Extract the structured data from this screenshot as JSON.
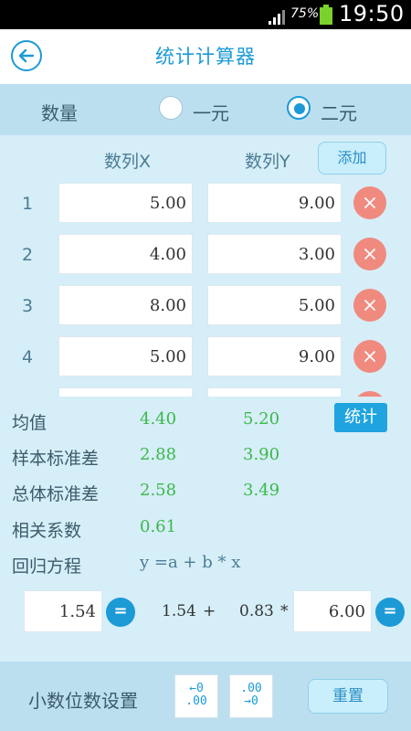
{
  "status_bar": {
    "battery_pct": "75%",
    "time": "19:50",
    "signal_icon": "signal-icon",
    "battery_icon": "battery-icon"
  },
  "header": {
    "title": "统计计算器",
    "back_icon": "back-arrow-icon"
  },
  "mode": {
    "label": "数量",
    "options": [
      "一元",
      "二元"
    ],
    "selected": "二元"
  },
  "table": {
    "col_x": "数列X",
    "col_y": "数列Y",
    "add_label": "添加",
    "rows": [
      {
        "index": "1",
        "x": "5.00",
        "y": "9.00"
      },
      {
        "index": "2",
        "x": "4.00",
        "y": "3.00"
      },
      {
        "index": "3",
        "x": "8.00",
        "y": "5.00"
      },
      {
        "index": "4",
        "x": "5.00",
        "y": "9.00"
      }
    ]
  },
  "stats": {
    "button_label": "统计",
    "mean": {
      "label": "均值",
      "x": "4.40",
      "y": "5.20"
    },
    "sample_sd": {
      "label": "样本标准差",
      "x": "2.88",
      "y": "3.90"
    },
    "pop_sd": {
      "label": "总体标准差",
      "x": "2.58",
      "y": "3.49"
    },
    "correlation": {
      "label": "相关系数",
      "value": "0.61"
    },
    "regression": {
      "label": "回归方程",
      "formula": "y =a + b * x"
    }
  },
  "calc": {
    "a_value": "1.54",
    "eq_label": "=",
    "a_text": "1.54",
    "plus": "+",
    "b_text": "0.83",
    "times": "*",
    "x_value": "6.00"
  },
  "footer": {
    "label": "小数位数设置",
    "decrease_line1": "←0",
    "decrease_line2": ".00",
    "increase_line1": ".00",
    "increase_line2": "→0",
    "reset_label": "重置"
  },
  "colors": {
    "accent": "#1b9ad6",
    "result_green": "#3cb84a",
    "delete_red": "#f08a7f"
  }
}
